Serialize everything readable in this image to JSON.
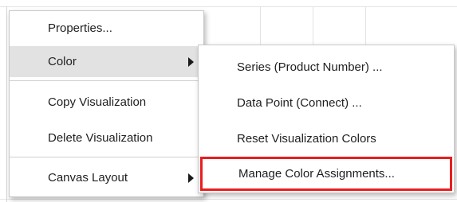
{
  "context_menu": {
    "items": [
      {
        "label": "Properties...",
        "has_submenu": false
      },
      {
        "label": "Color",
        "has_submenu": true,
        "active": true
      },
      {
        "label": "Copy Visualization",
        "has_submenu": false
      },
      {
        "label": "Delete Visualization",
        "has_submenu": false
      },
      {
        "label": "Canvas Layout",
        "has_submenu": true
      }
    ]
  },
  "color_submenu": {
    "items": [
      {
        "label": "Series (Product Number) ..."
      },
      {
        "label": "Data Point (Connect) ..."
      },
      {
        "label": "Reset Visualization Colors"
      },
      {
        "label": "Manage Color Assignments...",
        "highlighted_outline": true
      }
    ]
  },
  "colors": {
    "outline_highlight": "#e81e1e",
    "active_item_bg": "#e2e2e2",
    "menu_border": "#c9c9c9"
  },
  "icons": {
    "submenu_arrow": "triangle-right-icon"
  }
}
